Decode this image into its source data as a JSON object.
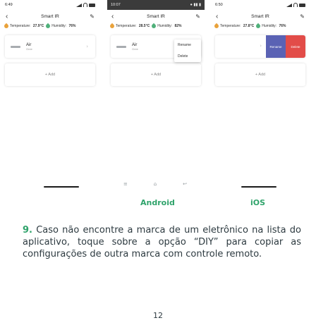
{
  "screens": [
    {
      "time": "6:49",
      "title": "Smart IR",
      "temperature_label": "Temperature:",
      "temperature_value": "27.9°C",
      "humidity_label": "Humidity:",
      "humidity_value": "76%",
      "device_name": "Air",
      "device_sub": "Gree",
      "add_label": "+ Add"
    },
    {
      "time": "10:07",
      "title": "Smart IR",
      "temperature_label": "Temperature:",
      "temperature_value": "28.5°C",
      "humidity_label": "Humidity:",
      "humidity_value": "82%",
      "device_name": "Air",
      "device_sub": "Gree",
      "add_label": "+ Add",
      "menu": [
        "Rename",
        "Delete"
      ]
    },
    {
      "time": "6:50",
      "title": "Smart IR",
      "temperature_label": "Temperature:",
      "temperature_value": "27.8°C",
      "humidity_label": "Humidity:",
      "humidity_value": "76%",
      "add_label": "+ Add",
      "swipe_rename": "Rename",
      "swipe_delete": "Delete"
    }
  ],
  "captions": {
    "android": "Android",
    "ios": "iOS"
  },
  "step": {
    "number": "9.",
    "text": "Caso não encontre a marca de um eletrônico na lista do aplicativo, toque sobre a opção “DIY” para copiar as configurações de outra marca com controle remoto."
  },
  "page_number": "12",
  "colors": {
    "accent": "#2fa36b",
    "rename": "#5a62b4",
    "delete": "#e24c48"
  },
  "icons": {
    "back": "chevron-left-icon",
    "edit": "pencil-icon",
    "temperature": "drop-icon",
    "humidity": "drop-icon"
  }
}
